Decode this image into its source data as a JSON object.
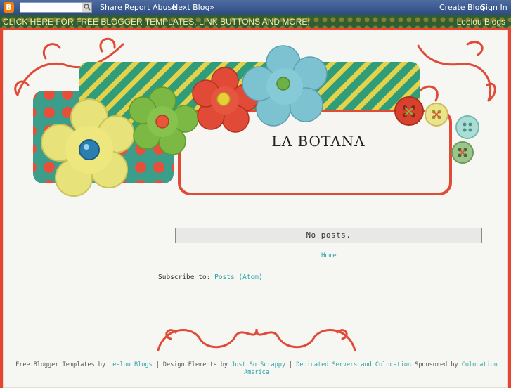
{
  "navbar": {
    "logo": "B",
    "links": {
      "share": "Share",
      "report_abuse": "Report Abuse",
      "next_blog": "Next Blog»",
      "create_blog": "Create Blog",
      "sign_in": "Sign In"
    }
  },
  "promo": {
    "left": "CLICK HERE FOR FREE BLOGGER TEMPLATES, LINK BUTTONS AND MORE!",
    "right": "Leelou Blogs"
  },
  "blog": {
    "title": "LA BOTANA",
    "no_posts": "No posts.",
    "home": "Home",
    "subscribe_label": "Subscribe to:",
    "subscribe_link": "Posts (Atom)"
  },
  "footer": {
    "t1": "Free Blogger Templates by",
    "l1": "Leelou Blogs",
    "t2": " | Design Elements by",
    "l2": "Just So Scrappy",
    "t3": " | ",
    "l3": "Dedicated Servers and Colocation",
    "t4": " Sponsored by",
    "l4": "Colocation America"
  },
  "colors": {
    "frame_red": "#e8442f",
    "accent_teal": "#2aa6a6",
    "navbar_blue": "#2b4a80"
  }
}
